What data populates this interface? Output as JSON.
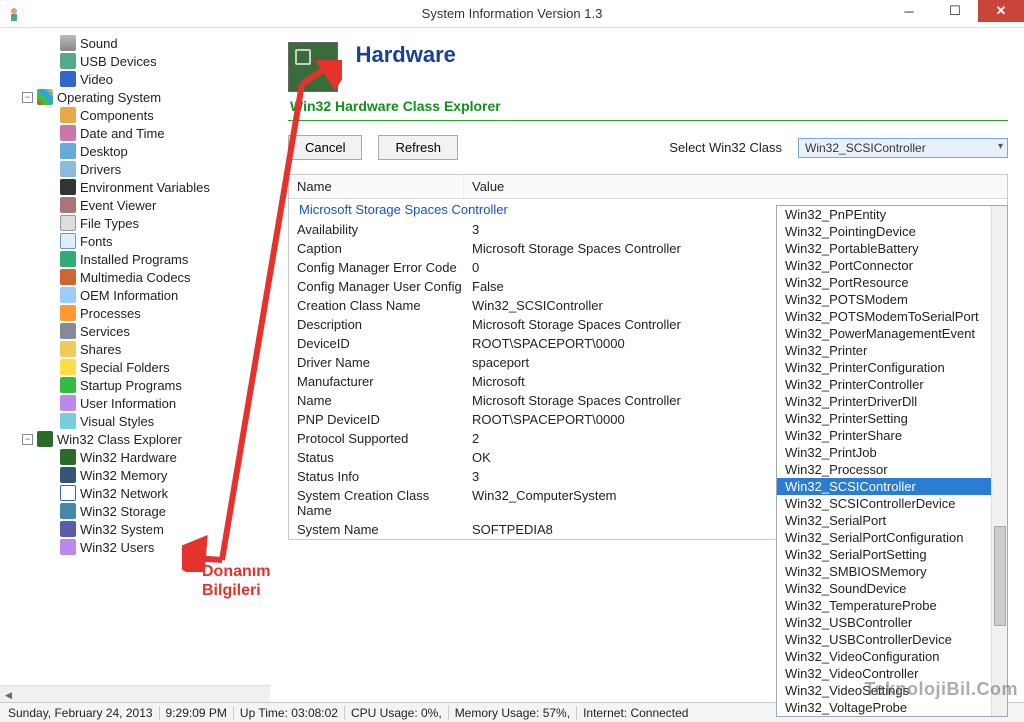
{
  "titlebar": {
    "title": "System Information Version 1.3"
  },
  "tree": {
    "sys": "Operating System",
    "items1": [
      {
        "label": "Sound"
      },
      {
        "label": "USB Devices"
      },
      {
        "label": "Video"
      }
    ],
    "items2": [
      {
        "label": "Components"
      },
      {
        "label": "Date and Time"
      },
      {
        "label": "Desktop"
      },
      {
        "label": "Drivers"
      },
      {
        "label": "Environment Variables"
      },
      {
        "label": "Event Viewer"
      },
      {
        "label": "File Types"
      },
      {
        "label": "Fonts"
      },
      {
        "label": "Installed Programs"
      },
      {
        "label": "Multimedia Codecs"
      },
      {
        "label": "OEM Information"
      },
      {
        "label": "Processes"
      },
      {
        "label": "Services"
      },
      {
        "label": "Shares"
      },
      {
        "label": "Special Folders"
      },
      {
        "label": "Startup Programs"
      },
      {
        "label": "User Information"
      },
      {
        "label": "Visual Styles"
      }
    ],
    "w32": "Win32 Class Explorer",
    "items3": [
      {
        "label": "Win32 Hardware"
      },
      {
        "label": "Win32 Memory"
      },
      {
        "label": "Win32 Network"
      },
      {
        "label": "Win32 Storage"
      },
      {
        "label": "Win32 System"
      },
      {
        "label": "Win32 Users"
      }
    ]
  },
  "header": {
    "title": "Hardware",
    "sub": "Win32 Hardware Class Explorer"
  },
  "toolbar": {
    "cancel": "Cancel",
    "refresh": "Refresh",
    "select_label": "Select Win32 Class",
    "selected": "Win32_SCSIController"
  },
  "table": {
    "col1": "Name",
    "col2": "Value",
    "group": "Microsoft Storage Spaces Controller",
    "rows": [
      {
        "n": "Availability",
        "v": "3"
      },
      {
        "n": "Caption",
        "v": "Microsoft Storage Spaces Controller"
      },
      {
        "n": "Config Manager Error Code",
        "v": "0"
      },
      {
        "n": "Config Manager User Config",
        "v": "False"
      },
      {
        "n": "Creation Class Name",
        "v": "Win32_SCSIController"
      },
      {
        "n": "Description",
        "v": "Microsoft Storage Spaces Controller"
      },
      {
        "n": "DeviceID",
        "v": "ROOT\\SPACEPORT\\0000"
      },
      {
        "n": "Driver Name",
        "v": "spaceport"
      },
      {
        "n": "Manufacturer",
        "v": "Microsoft"
      },
      {
        "n": "Name",
        "v": "Microsoft Storage Spaces Controller"
      },
      {
        "n": "PNP DeviceID",
        "v": "ROOT\\SPACEPORT\\0000"
      },
      {
        "n": "Protocol Supported",
        "v": "2"
      },
      {
        "n": "Status",
        "v": "OK"
      },
      {
        "n": "Status Info",
        "v": "3"
      },
      {
        "n": "System Creation Class Name",
        "v": "Win32_ComputerSystem"
      },
      {
        "n": "System Name",
        "v": "SOFTPEDIA8"
      }
    ]
  },
  "dropdown": {
    "options": [
      "Win32_PnPEntity",
      "Win32_PointingDevice",
      "Win32_PortableBattery",
      "Win32_PortConnector",
      "Win32_PortResource",
      "Win32_POTSModem",
      "Win32_POTSModemToSerialPort",
      "Win32_PowerManagementEvent",
      "Win32_Printer",
      "Win32_PrinterConfiguration",
      "Win32_PrinterController",
      "Win32_PrinterDriverDll",
      "Win32_PrinterSetting",
      "Win32_PrinterShare",
      "Win32_PrintJob",
      "Win32_Processor",
      "Win32_SCSIController",
      "Win32_SCSIControllerDevice",
      "Win32_SerialPort",
      "Win32_SerialPortConfiguration",
      "Win32_SerialPortSetting",
      "Win32_SMBIOSMemory",
      "Win32_SoundDevice",
      "Win32_TemperatureProbe",
      "Win32_USBController",
      "Win32_USBControllerDevice",
      "Win32_VideoConfiguration",
      "Win32_VideoController",
      "Win32_VideoSettings",
      "Win32_VoltageProbe"
    ],
    "selected_index": 16
  },
  "status": {
    "date": "Sunday, February 24, 2013",
    "time": "9:29:09 PM",
    "uptime": "Up Time: 03:08:02",
    "cpu": "CPU Usage: 0%,",
    "mem": "Memory Usage: 57%,",
    "net": "Internet: Connected"
  },
  "annotation": {
    "text1": "Donanım",
    "text2": "Bilgileri"
  },
  "watermark": "TeknolojiBil.Com"
}
